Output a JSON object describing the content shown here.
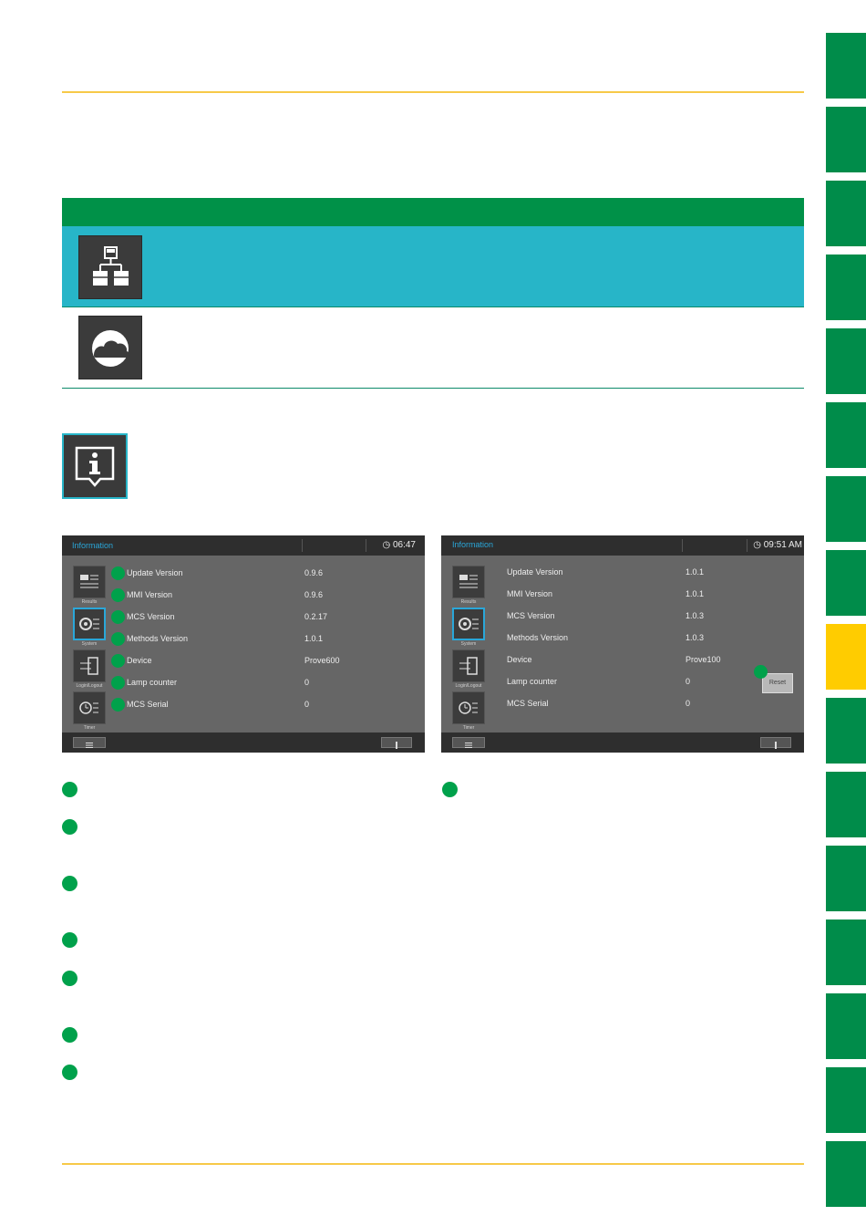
{
  "colors": {
    "accent_green": "#009148",
    "cyan_row": "#27b5c8",
    "yellow_rule": "#f7c948",
    "active_tab": "#ffcc00"
  },
  "tabs": {
    "count": 17,
    "active_index": 8
  },
  "table": {
    "rows": [
      {
        "icon": "network-hierarchy-icon"
      },
      {
        "icon": "cloud-icon"
      }
    ]
  },
  "info_icon": "info-icon",
  "screen_left": {
    "title": "Information",
    "time": "06:47",
    "nav": [
      {
        "icon": "results-icon",
        "caption": "Results"
      },
      {
        "icon": "system-icon",
        "caption": "System"
      },
      {
        "icon": "login-logout-icon",
        "caption": "Login/Logout"
      },
      {
        "icon": "timer-icon",
        "caption": "Timer"
      }
    ],
    "rows": [
      {
        "label": "Update Version",
        "value": "0.9.6"
      },
      {
        "label": "MMI Version",
        "value": "0.9.6"
      },
      {
        "label": "MCS Version",
        "value": "0.2.17"
      },
      {
        "label": "Methods Version",
        "value": "1.0.1"
      },
      {
        "label": "Device",
        "value": "Prove600"
      },
      {
        "label": "Lamp counter",
        "value": "0"
      },
      {
        "label": "MCS Serial",
        "value": "0"
      }
    ]
  },
  "screen_right": {
    "title": "Information",
    "time": "09:51 AM",
    "reset_label": "Reset",
    "nav": [
      {
        "icon": "results-icon",
        "caption": "Results"
      },
      {
        "icon": "system-icon",
        "caption": "System"
      },
      {
        "icon": "login-logout-icon",
        "caption": "Login/Logout"
      },
      {
        "icon": "timer-icon",
        "caption": "Timer"
      }
    ],
    "rows": [
      {
        "label": "Update Version",
        "value": "1.0.1"
      },
      {
        "label": "MMI Version",
        "value": "1.0.1"
      },
      {
        "label": "MCS Version",
        "value": "1.0.3"
      },
      {
        "label": "Methods Version",
        "value": "1.0.3"
      },
      {
        "label": "Device",
        "value": "Prove100"
      },
      {
        "label": "Lamp counter",
        "value": "0"
      },
      {
        "label": "MCS Serial",
        "value": "0"
      }
    ]
  }
}
